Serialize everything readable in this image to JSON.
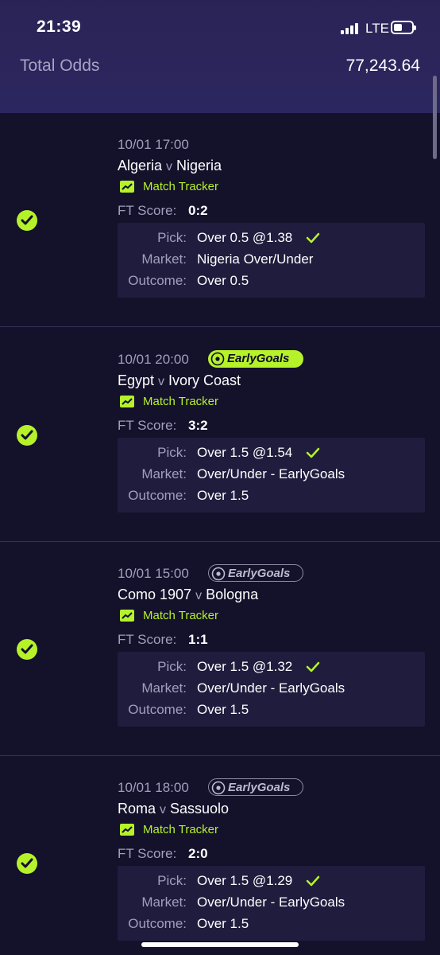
{
  "status_bar": {
    "time": "21:39",
    "network": "LTE"
  },
  "summary": {
    "total_odds_label": "Total Odds",
    "total_odds_value": "77,243.64"
  },
  "labels": {
    "match_tracker": "Match Tracker",
    "ft_score": "FT Score:",
    "pick": "Pick:",
    "market": "Market:",
    "outcome": "Outcome:",
    "vs": "v",
    "early_goals": "EarlyGoals"
  },
  "colors": {
    "accent": "#b6f22a",
    "background": "#14112b",
    "header": "#2a2456"
  },
  "bets": [
    {
      "datetime": "10/01 17:00",
      "home": "Algeria",
      "away": "Nigeria",
      "early_goals_badge": "none",
      "ft_score": "0:2",
      "pick": "Over 0.5 @1.38",
      "market": "Nigeria Over/Under",
      "outcome": "Over 0.5",
      "status_icon": "check-circle-icon"
    },
    {
      "datetime": "10/01 20:00",
      "home": "Egypt",
      "away": "Ivory Coast",
      "early_goals_badge": "active",
      "ft_score": "3:2",
      "pick": "Over 1.5 @1.54",
      "market": "Over/Under - EarlyGoals",
      "outcome": "Over 1.5",
      "status_icon": "check-circle-icon"
    },
    {
      "datetime": "10/01 15:00",
      "home": "Como 1907",
      "away": "Bologna",
      "early_goals_badge": "inactive",
      "ft_score": "1:1",
      "pick": "Over 1.5 @1.32",
      "market": "Over/Under - EarlyGoals",
      "outcome": "Over 1.5",
      "status_icon": "check-circle-icon"
    },
    {
      "datetime": "10/01 18:00",
      "home": "Roma",
      "away": "Sassuolo",
      "early_goals_badge": "inactive",
      "ft_score": "2:0",
      "pick": "Over 1.5 @1.29",
      "market": "Over/Under - EarlyGoals",
      "outcome": "Over 1.5",
      "status_icon": "check-circle-icon"
    }
  ]
}
